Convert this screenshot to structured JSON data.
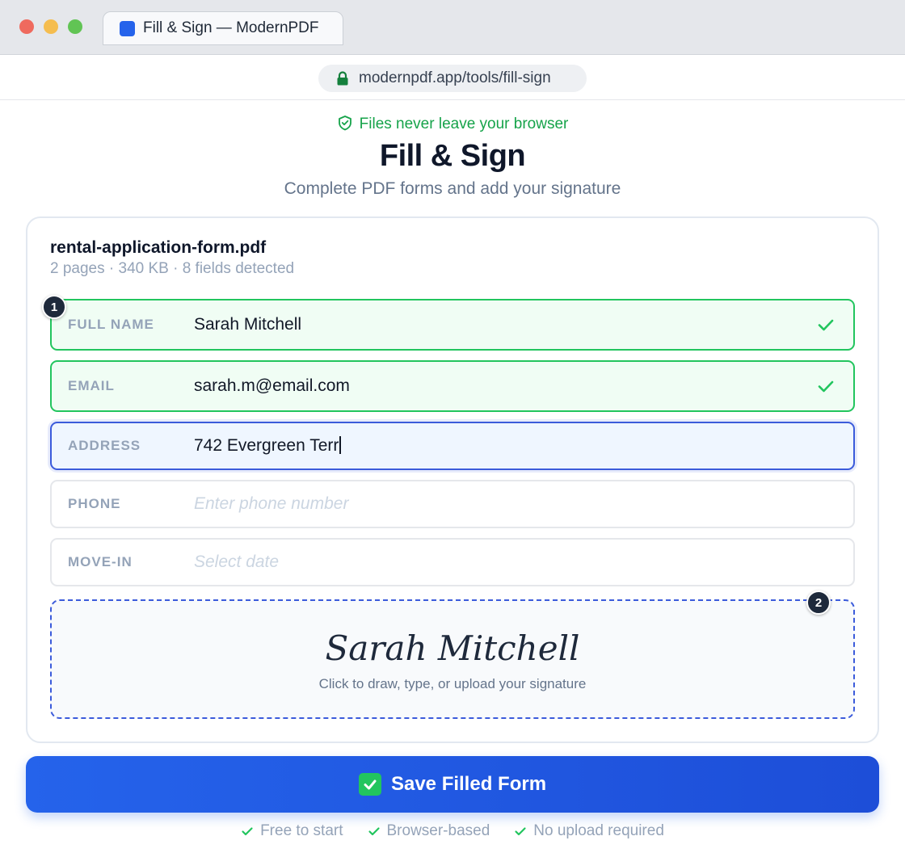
{
  "browser": {
    "tab_title": "Fill & Sign — ModernPDF",
    "url": "modernpdf.app/tools/fill-sign"
  },
  "header": {
    "privacy_note": "Files never leave your browser",
    "title": "Fill & Sign",
    "subtitle": "Complete PDF forms and add your signature"
  },
  "file": {
    "name": "rental-application-form.pdf",
    "meta": "2 pages · 340 KB · 8 fields detected"
  },
  "steps": {
    "first": "1",
    "second": "2"
  },
  "fields": [
    {
      "label": "FULL NAME",
      "value": "Sarah Mitchell",
      "state": "filled"
    },
    {
      "label": "EMAIL",
      "value": "sarah.m@email.com",
      "state": "filled"
    },
    {
      "label": "ADDRESS",
      "value": "742 Evergreen Terr",
      "state": "active"
    },
    {
      "label": "PHONE",
      "placeholder": "Enter phone number",
      "state": "empty"
    },
    {
      "label": "MOVE-IN",
      "placeholder": "Select date",
      "state": "empty"
    }
  ],
  "signature": {
    "name": "Sarah Mitchell",
    "hint": "Click to draw, type, or upload your signature"
  },
  "actions": {
    "save_label": "Save Filled Form"
  },
  "features": [
    "Free to start",
    "Browser-based",
    "No upload required"
  ],
  "colors": {
    "accent": "#2563eb",
    "success": "#22c55e",
    "active_border": "#3b5bdb",
    "muted": "#94a3b8"
  }
}
